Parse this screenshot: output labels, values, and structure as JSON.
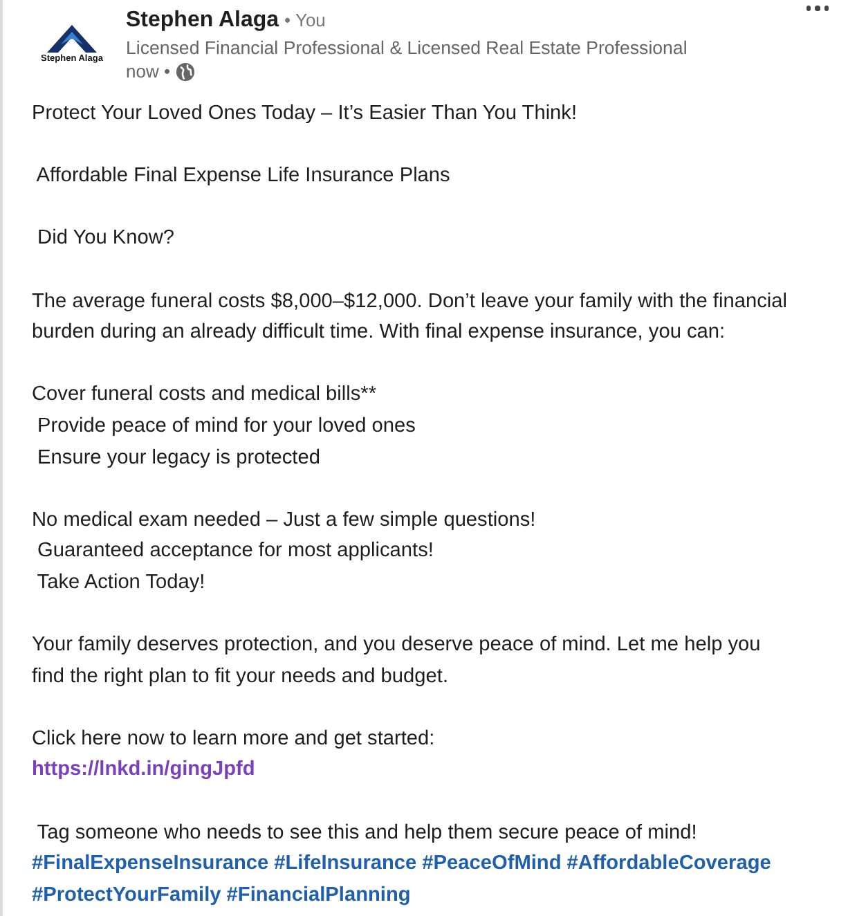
{
  "post": {
    "author": {
      "logo_text": "Stephen Alaga",
      "name": "Stephen Alaga",
      "relation": "• You",
      "headline": "Licensed Financial Professional & Licensed Real Estate Professional",
      "time": "now •"
    },
    "paragraphs": [
      {
        "kind": "text",
        "lines": [
          "Protect Your Loved Ones Today – It’s Easier Than You Think!"
        ]
      },
      {
        "kind": "text",
        "lines": [
          " Affordable Final Expense Life Insurance Plans"
        ]
      },
      {
        "kind": "text",
        "lines": [
          " Did You Know?"
        ]
      },
      {
        "kind": "text",
        "lines": [
          "The average funeral costs $8,000–$12,000. Don’t leave your family with the financial",
          "burden during an already difficult time. With final expense insurance, you can:"
        ]
      },
      {
        "kind": "text",
        "lines": [
          "Cover funeral costs and medical bills**",
          " Provide peace of mind for your loved ones",
          " Ensure your legacy is protected"
        ]
      },
      {
        "kind": "text",
        "lines": [
          "No medical exam needed – Just a few simple questions!",
          " Guaranteed acceptance for most applicants!",
          " Take Action Today!"
        ]
      },
      {
        "kind": "text",
        "lines": [
          "Your family deserves protection, and you deserve peace of mind. Let me help you",
          "find the right plan to fit your needs and budget."
        ]
      },
      {
        "kind": "link",
        "lines": [
          "Click here now to learn more and get started:"
        ],
        "url": "https://lnkd.in/gingJpfd"
      },
      {
        "kind": "hashtags",
        "lines": [
          " Tag someone who needs to see this and help them secure peace of mind!"
        ],
        "tags": [
          "#FinalExpenseInsurance",
          "#LifeInsurance",
          "#PeaceOfMind",
          "#AffordableCoverage",
          "#ProtectYourFamily",
          "#FinancialPlanning"
        ]
      }
    ]
  }
}
